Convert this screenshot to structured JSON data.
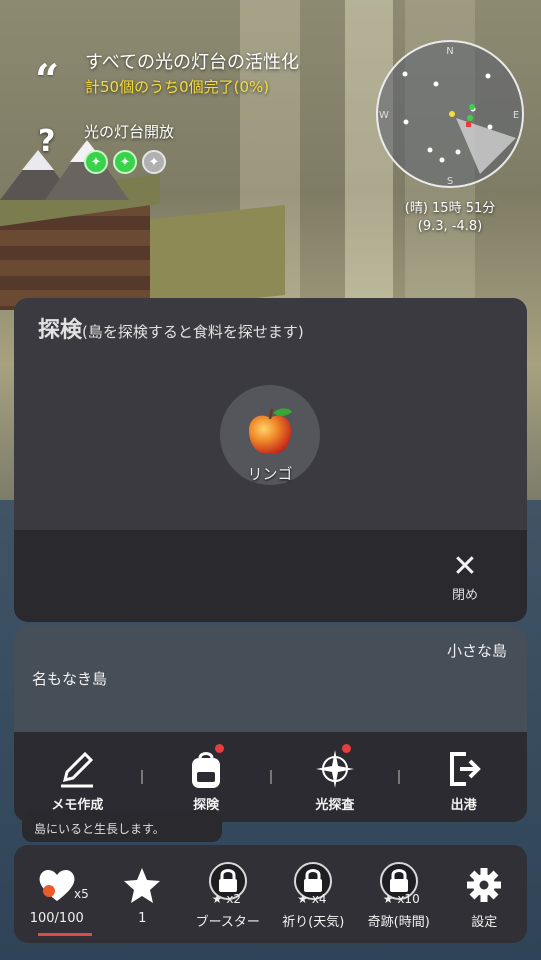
{
  "quest": {
    "title": "すべての光の灯台の活性化",
    "progress": "計50個のうち0個完了(0%)"
  },
  "lighthouse": {
    "title": "光の灯台開放",
    "states": [
      "active",
      "active",
      "inactive"
    ]
  },
  "radar": {
    "directions": {
      "north": "N",
      "east": "E",
      "south": "S",
      "west": "W"
    }
  },
  "weather": {
    "line1": "(晴) 15時 51分",
    "line2": "(9.3, -4.8)"
  },
  "explore_panel": {
    "title": "探検",
    "subtitle": "(島を探検すると食料を探せます)",
    "item_name": "リンゴ",
    "close_label": "閉め"
  },
  "island": {
    "type": "小さな島",
    "name": "名もなき島"
  },
  "actions": [
    {
      "label": "メモ作成",
      "icon": "pencil-icon"
    },
    {
      "label": "探険",
      "icon": "backpack-icon"
    },
    {
      "label": "光探査",
      "icon": "compass-icon"
    },
    {
      "label": "出港",
      "icon": "exit-icon"
    }
  ],
  "tooltip": {
    "text": "島にいると生長します。"
  },
  "bottom_bar": {
    "heart": {
      "multiplier": "x5",
      "value": "100/100",
      "fill": 1.0
    },
    "star": {
      "value": "1"
    },
    "booster": {
      "multiplier": "x2",
      "label": "ブースター"
    },
    "prayer": {
      "multiplier": "x4",
      "label": "祈り(天気)"
    },
    "miracle": {
      "multiplier": "x10",
      "label": "奇跡(時間)"
    },
    "settings": {
      "label": "設定"
    }
  },
  "colors": {
    "accent_yellow": "#f5dd3c",
    "badge_red": "#e63d3d",
    "green_active": "#3ad24a"
  }
}
